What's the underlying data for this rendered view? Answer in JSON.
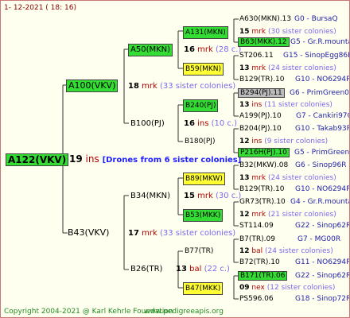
{
  "date": "1- 12-2021 ( 18: 16)",
  "copyright": "Copyright 2004-2021 @ Karl Kehrle Foundation",
  "url": "www.pedigreeapis.org",
  "root": {
    "label": "A122(VKV)",
    "num": "19",
    "unit": "ins",
    "note": "[Drones from 6 sister colonies]"
  },
  "level1": [
    {
      "label": "A100(VKV)",
      "num": "18",
      "unit": "mrk",
      "count": "(33 sister colonies)"
    },
    {
      "label": "B43(VKV)",
      "num": "17",
      "unit": "mrk",
      "count": "(33 sister colonies)"
    }
  ],
  "level2": [
    {
      "label": "A50(MKN)",
      "num": "16",
      "unit": "mrk",
      "count": "(28 c.)"
    },
    {
      "label": "B100(PJ)",
      "num": "16",
      "unit": "ins",
      "count": "(10 c.)"
    },
    {
      "label": "B34(MKN)",
      "num": "15",
      "unit": "mrk",
      "count": "(30 c.)"
    },
    {
      "label": "B26(TR)",
      "num": "13",
      "unit": "bal",
      "count": "(22 c.)"
    }
  ],
  "level3": [
    {
      "label": "A131(MKN)",
      "num": "15",
      "unit": "mrk",
      "count": "(30 sister colonies)"
    },
    {
      "label": "B59(MKN)",
      "num": "13",
      "unit": "mrk",
      "count": "(24 sister colonies)"
    },
    {
      "label": "B240(PJ)",
      "num": "13",
      "unit": "ins",
      "count": "(11 sister colonies)"
    },
    {
      "label": "B180(PJ)",
      "num": "12",
      "unit": "ins",
      "count": "(9 sister colonies)"
    },
    {
      "label": "B89(MKW)",
      "num": "13",
      "unit": "mrk",
      "count": "(24 sister colonies)"
    },
    {
      "label": "B53(MKK)",
      "num": "12",
      "unit": "mrk",
      "count": "(21 sister colonies)"
    },
    {
      "label": "B77(TR)",
      "num": "12",
      "unit": "bal",
      "count": "(24 sister colonies)"
    },
    {
      "label": "B47(MKK)",
      "num": "09",
      "unit": "nex",
      "count": "(12 sister colonies)"
    }
  ],
  "level4": [
    {
      "left": "A630(MKN).13",
      "right": "G0 - BursaQ"
    },
    {
      "left": "B63(MKK).12",
      "right": "G5 - Gr.R.mounta"
    },
    {
      "left": "ST206.11",
      "right": "G15 - SinopEgg86R"
    },
    {
      "left": "B129(TR).10",
      "right": "G10 - NO6294R"
    },
    {
      "left": "B294(PJ).11",
      "right": "G6 - PrimGreen00"
    },
    {
      "left": "A199(PJ).10",
      "right": "G7 - Cankiri97Q"
    },
    {
      "left": "B204(PJ).10",
      "right": "G10 - Takab93R"
    },
    {
      "left": "P216H(PJ).10",
      "right": "G5 - PrimGreen00"
    },
    {
      "left": "B32(MKW).08",
      "right": "G6 - Sinop96R"
    },
    {
      "left": "B129(TR).10",
      "right": "G10 - NO6294R"
    },
    {
      "left": "GR73(TR).10",
      "right": "G4 - Gr.R.mounta"
    },
    {
      "left": "ST114.09",
      "right": "G22 - Sinop62R"
    },
    {
      "left": "B7(TR).09",
      "right": "G7 - MG00R"
    },
    {
      "left": "B72(TR).10",
      "right": "G11 - NO6294R"
    },
    {
      "left": "B171(TR).06",
      "right": "G22 - Sinop62R"
    },
    {
      "left": "PS596.06",
      "right": "G18 - Sinop72R"
    }
  ],
  "colors": {
    "green": "#33dd33",
    "yellow": "#ffff33",
    "grey": "#bbbbbb",
    "line": "#333333"
  }
}
